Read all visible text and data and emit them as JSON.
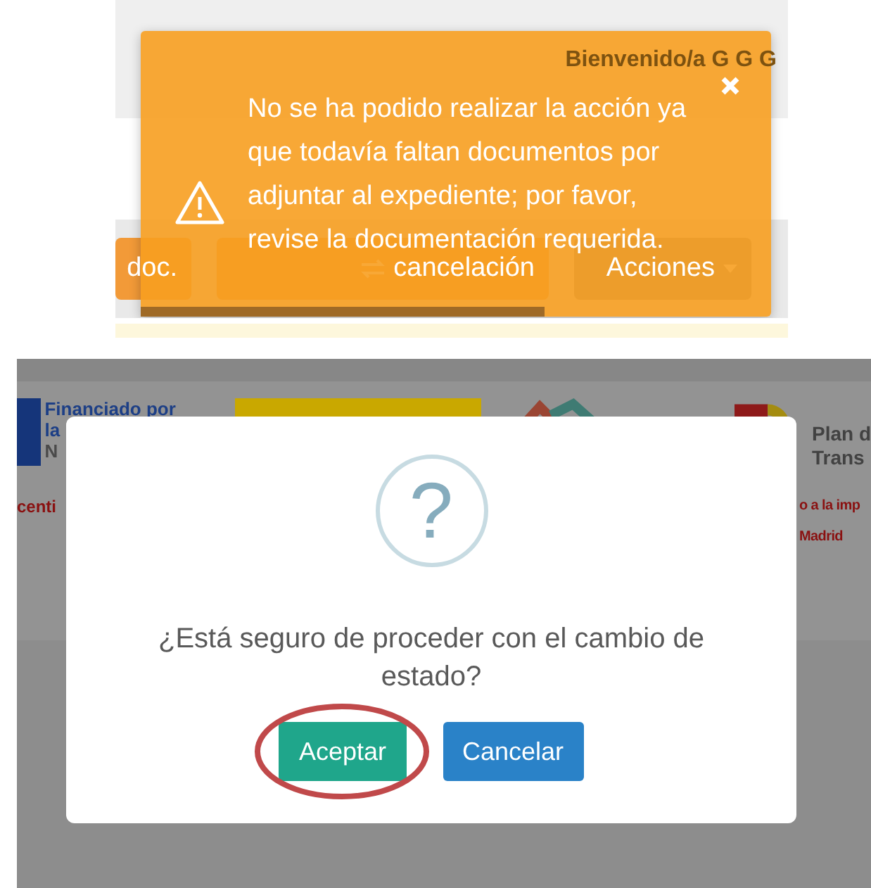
{
  "alert_screenshot": {
    "header": {
      "welcome": "Bienvenido/a G G G"
    },
    "toolbar_buttons": [
      {
        "label": "doc.",
        "kind": "plain"
      },
      {
        "label": "cancelación",
        "kind": "exchange"
      },
      {
        "label": "Acciones",
        "kind": "dropdown"
      }
    ],
    "toast": {
      "message": "No se ha podido realizar la acción ya que todavía faltan documentos por adjuntar al expediente; por favor, revise la documentación requerida.",
      "level": 0.64
    }
  },
  "dialog_screenshot": {
    "background": {
      "funding_lines": [
        "Financiado por",
        "la",
        "N"
      ],
      "plan_lines": [
        "Plan d",
        "Trans"
      ],
      "left_note": "centi",
      "right_notes": [
        "o a la imp",
        "Madrid"
      ]
    },
    "dialog": {
      "icon_glyph": "?",
      "message": "¿Está seguro de proceder con el cambio de estado?",
      "buttons": [
        {
          "label": "Aceptar",
          "kind": "confirm",
          "highlighted": true
        },
        {
          "label": "Cancelar",
          "kind": "cancel",
          "highlighted": false
        }
      ]
    }
  }
}
